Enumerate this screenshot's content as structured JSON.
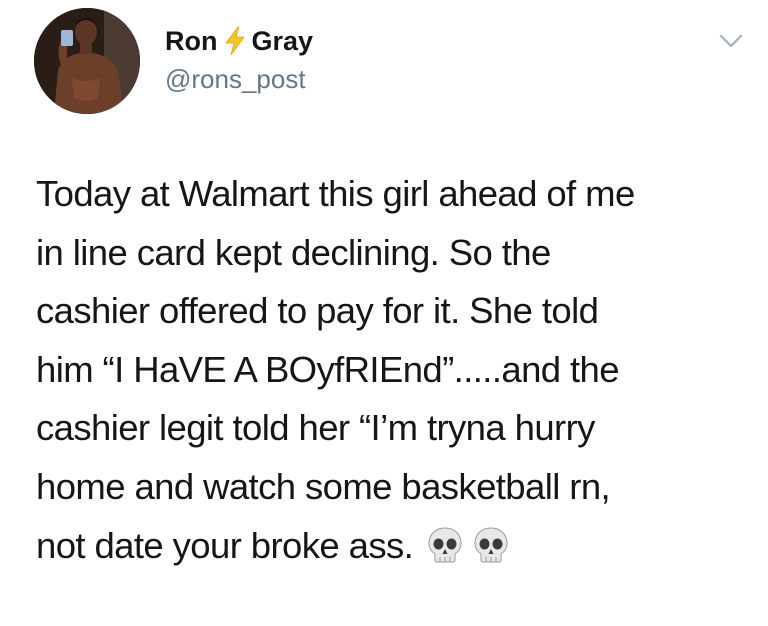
{
  "author": {
    "name_first": "Ron",
    "name_last": "Gray",
    "handle": "@rons_post"
  },
  "icons": {
    "name_emoji": "high-voltage-icon",
    "menu": "chevron-down-icon",
    "trailing_emoji": "skull-icon"
  },
  "tweet": {
    "text": "Today at Walmart this girl ahead of me\nin line card kept declining. So the\ncashier offered to pay for it. She told\nhim “I HaVE A BOyfRIEnd”.....and the\ncashier legit told her “I’m tryna hurry\nhome and watch some basketball rn,\nnot date your broke ass.",
    "emoji_count": 2
  },
  "colors": {
    "text": "#14171a",
    "secondary": "#657786",
    "bolt": "#f4c430",
    "caret": "#aab8c2"
  }
}
